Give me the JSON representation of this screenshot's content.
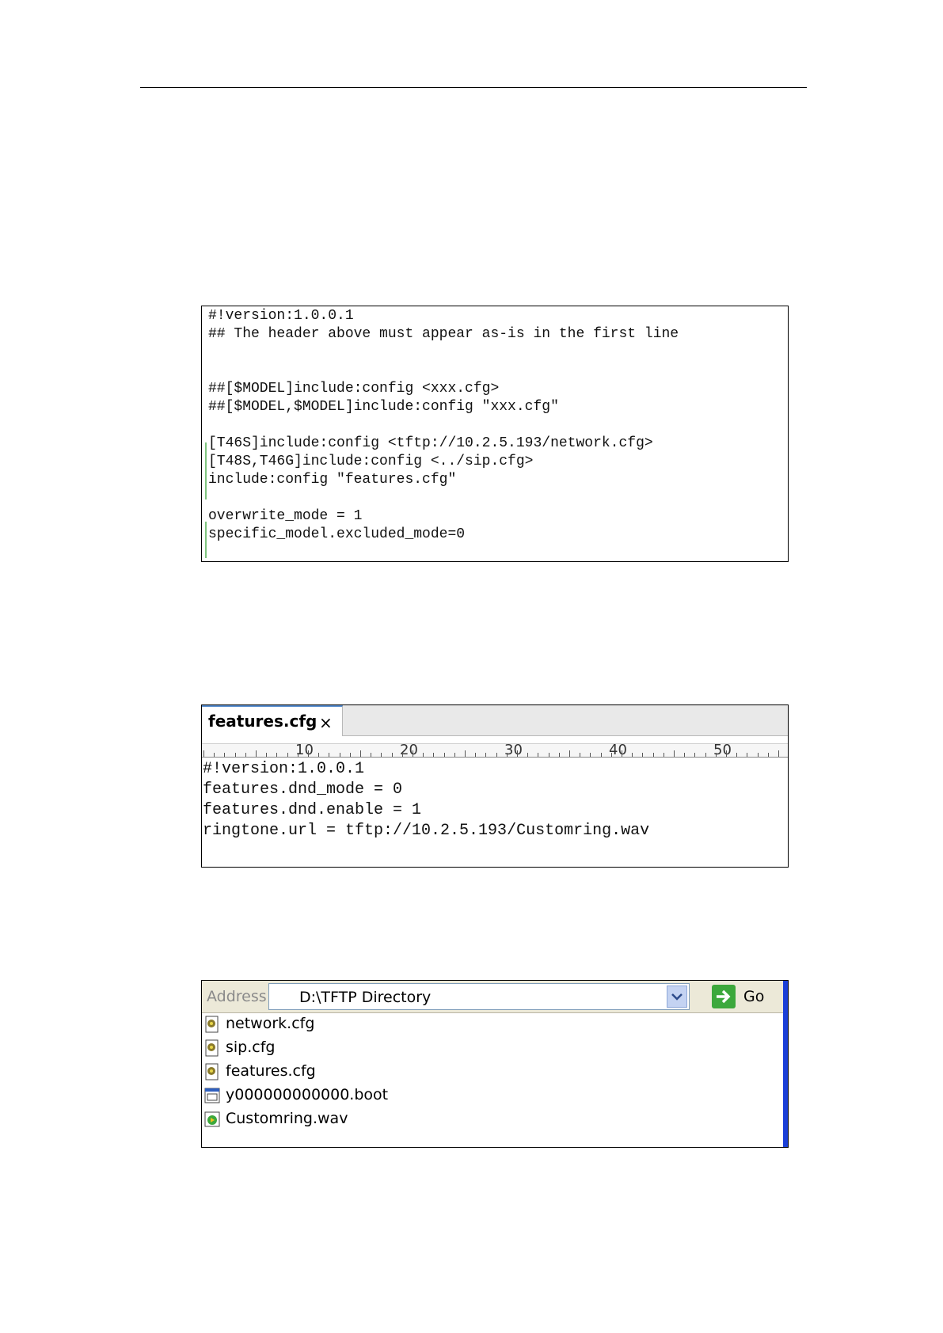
{
  "figure1": {
    "lines": [
      "#!version:1.0.0.1",
      "## The header above must appear as-is in the first line",
      "",
      "",
      "##[$MODEL]include:config <xxx.cfg>",
      "##[$MODEL,$MODEL]include:config \"xxx.cfg\"",
      "",
      "[T46S]include:config <tftp://10.2.5.193/network.cfg>",
      "[T48S,T46G]include:config <../sip.cfg>",
      "include:config \"features.cfg\"",
      "",
      "overwrite_mode = 1",
      "specific_model.excluded_mode=0"
    ]
  },
  "figure2": {
    "tab_label": "features.cfg",
    "tab_close": "×",
    "ruler_numbers": [
      "10",
      "20",
      "30",
      "40",
      "50"
    ],
    "lines": [
      "#!version:1.0.0.1",
      "features.dnd_mode = 0",
      "features.dnd.enable = 1",
      "ringtone.url = tftp://10.2.5.193/Customring.wav"
    ]
  },
  "figure3": {
    "address_label": "Address",
    "address_value": "D:\\TFTP Directory",
    "go_label": "Go",
    "files": [
      {
        "name": "network.cfg",
        "icon": "config-file-icon"
      },
      {
        "name": "sip.cfg",
        "icon": "config-file-icon"
      },
      {
        "name": "features.cfg",
        "icon": "config-file-icon"
      },
      {
        "name": "y000000000000.boot",
        "icon": "boot-file-icon"
      },
      {
        "name": "Customring.wav",
        "icon": "audio-file-icon"
      }
    ]
  }
}
